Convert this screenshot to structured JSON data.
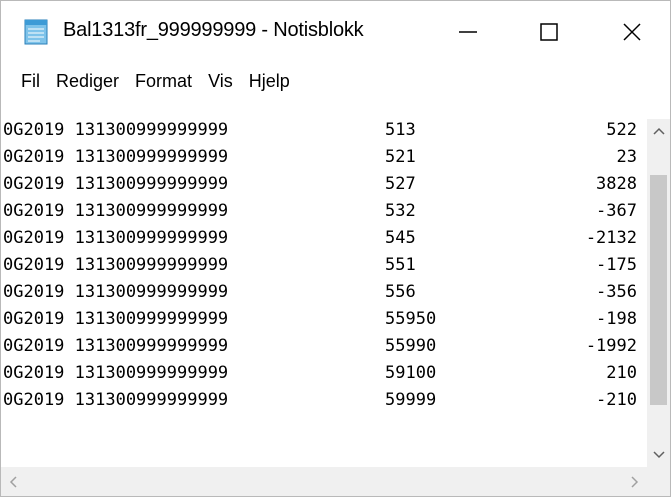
{
  "window": {
    "title": "Bal1313fr_999999999 - Notisblokk",
    "controls": {
      "minimize": "minimize-icon",
      "maximize": "maximize-icon",
      "close": "close-icon"
    }
  },
  "menu": {
    "items": [
      {
        "label": "Fil"
      },
      {
        "label": "Rediger"
      },
      {
        "label": "Format"
      },
      {
        "label": "Vis"
      },
      {
        "label": "Hjelp"
      }
    ]
  },
  "editor": {
    "rows": [
      {
        "id": "0G2019 131300999999999",
        "account": "513",
        "amount": "522"
      },
      {
        "id": "0G2019 131300999999999",
        "account": "521",
        "amount": "23"
      },
      {
        "id": "0G2019 131300999999999",
        "account": "527",
        "amount": "3828"
      },
      {
        "id": "0G2019 131300999999999",
        "account": "532",
        "amount": "-367"
      },
      {
        "id": "0G2019 131300999999999",
        "account": "545",
        "amount": "-2132"
      },
      {
        "id": "0G2019 131300999999999",
        "account": "551",
        "amount": "-175"
      },
      {
        "id": "0G2019 131300999999999",
        "account": "556",
        "amount": "-356"
      },
      {
        "id": "0G2019 131300999999999",
        "account": "55950",
        "amount": "-198"
      },
      {
        "id": "0G2019 131300999999999",
        "account": "55990",
        "amount": "-1992"
      },
      {
        "id": "0G2019 131300999999999",
        "account": "59100",
        "amount": "210"
      },
      {
        "id": "0G2019 131300999999999",
        "account": "59999",
        "amount": "-210"
      }
    ]
  },
  "colors": {
    "scrollbar_track": "#f0f0f0",
    "scrollbar_thumb": "#c8c8c8",
    "text": "#000000"
  }
}
